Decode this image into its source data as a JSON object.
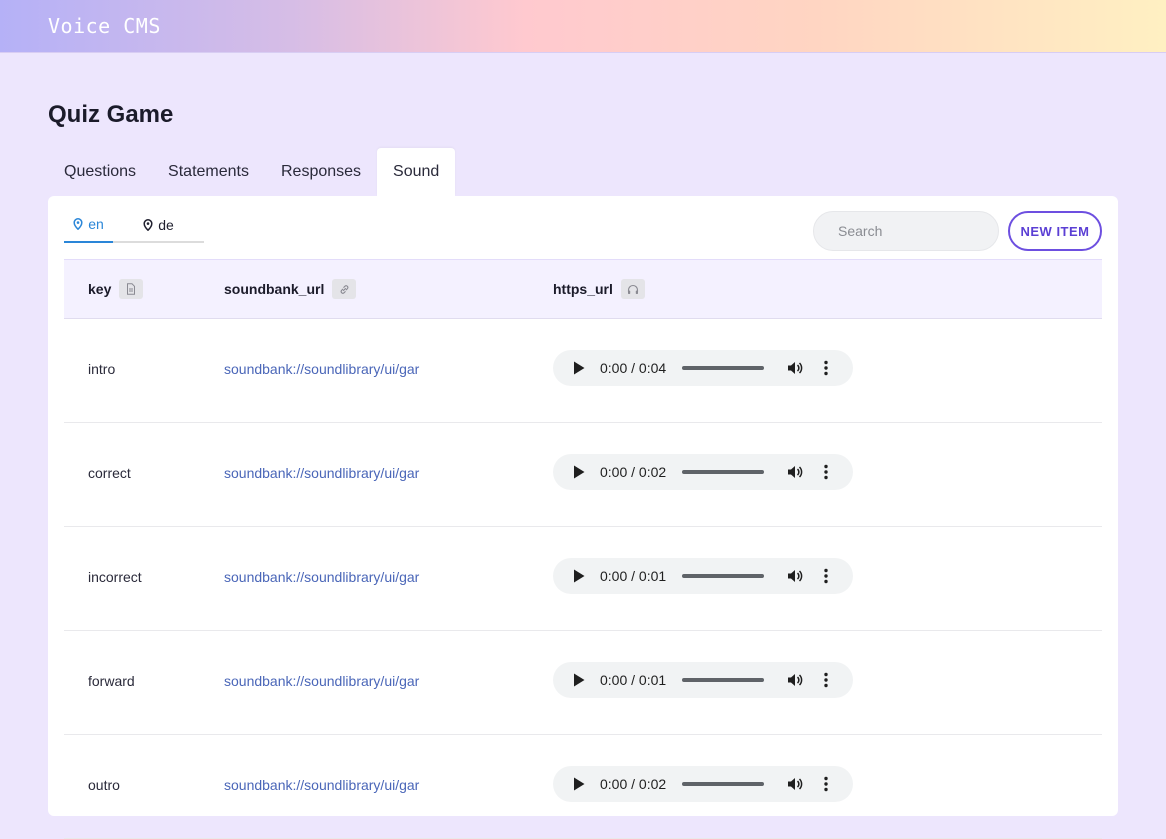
{
  "app": {
    "title": "Voice CMS"
  },
  "page": {
    "title": "Quiz Game"
  },
  "tabs": [
    {
      "label": "Questions",
      "active": false
    },
    {
      "label": "Statements",
      "active": false
    },
    {
      "label": "Responses",
      "active": false
    },
    {
      "label": "Sound",
      "active": true
    }
  ],
  "languages": [
    {
      "label": "en",
      "active": true,
      "icon": "map-pin-icon"
    },
    {
      "label": "de",
      "active": false,
      "icon": "map-pin-icon"
    }
  ],
  "search": {
    "placeholder": "Search",
    "value": ""
  },
  "new_item_label": "NEW ITEM",
  "table": {
    "columns": [
      {
        "label": "key",
        "icon": "file-icon"
      },
      {
        "label": "soundbank_url",
        "icon": "link-icon"
      },
      {
        "label": "https_url",
        "icon": "headphones-icon"
      }
    ],
    "rows": [
      {
        "key": "intro",
        "soundbank_url": "soundbank://soundlibrary/ui/gar",
        "time": "0:00 / 0:04"
      },
      {
        "key": "correct",
        "soundbank_url": "soundbank://soundlibrary/ui/gar",
        "time": "0:00 / 0:02"
      },
      {
        "key": "incorrect",
        "soundbank_url": "soundbank://soundlibrary/ui/gar",
        "time": "0:00 / 0:01"
      },
      {
        "key": "forward",
        "soundbank_url": "soundbank://soundlibrary/ui/gar",
        "time": "0:00 / 0:01"
      },
      {
        "key": "outro",
        "soundbank_url": "soundbank://soundlibrary/ui/gar",
        "time": "0:00 / 0:02"
      }
    ]
  },
  "colors": {
    "accent": "#6d4fe0",
    "active_language": "#2a86d8",
    "link": "#4a66b8",
    "background": "#ede6fd"
  }
}
